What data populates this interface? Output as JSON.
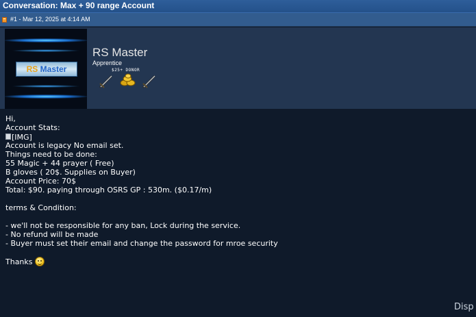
{
  "header": {
    "title": "Conversation: Max + 90 range Account"
  },
  "post": {
    "meta": "#1 - Mar 12, 2025 at 4:14 AM"
  },
  "profile": {
    "avatar_text_rs": "RS",
    "avatar_text_master": "Master",
    "username": "RS Master",
    "rank": "Apprentice",
    "badge_label": "$25+ DONOR"
  },
  "message": {
    "lines": [
      "Hi,",
      "Account Stats:",
      "[IMG]",
      "Account is legacy No email set.",
      "Things need to be done:",
      "55 Magic + 44 prayer ( Free)",
      "B gloves ( 20$. Supplies on Buyer)",
      "Account Price: 70$",
      "Total: $90. paying through OSRS GP : 530m. ($0.17/m)",
      "terms & Condition:",
      "- we'll not be responsible for any ban, Lock during the service.",
      "- No refund will be made",
      "- Buyer must set their email and change the password for mroe security",
      "Thanks"
    ]
  },
  "corner": {
    "text": "Disp"
  },
  "colors": {
    "background": "#0f1a2a",
    "title_bar": "#2e5e9a",
    "post_bar": "#325c8e",
    "profile_bg": "#233651"
  },
  "icons": [
    "post-icon",
    "broken-image-icon",
    "smiley-icon",
    "sword-icon",
    "gold-coins-icon"
  ]
}
